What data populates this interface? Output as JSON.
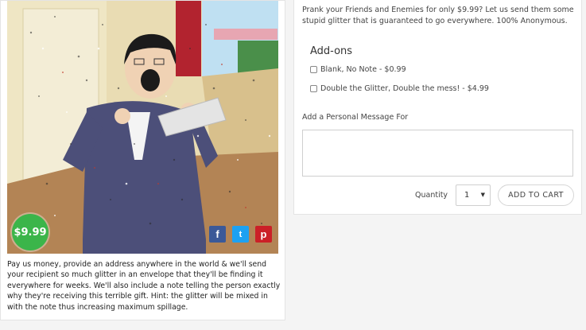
{
  "product": {
    "price_badge": "$9.99",
    "description": "Pay us money, provide an address anywhere in the world & we'll send your recipient so much glitter in an envelope that they'll be finding it everywhere for weeks. We'll also include a note telling the person exactly why they're receiving this terrible gift. Hint: the glitter will be mixed in with the note thus increasing maximum spillage.",
    "share": {
      "facebook": "f",
      "twitter": "t",
      "pinterest": "p"
    }
  },
  "purchase": {
    "intro": "Prank your Friends and Enemies for only $9.99? Let us send them some stupid glitter that is guaranteed to go everywhere. 100% Anonymous.",
    "addons_title": "Add-ons",
    "addons": [
      {
        "label": "Blank, No Note - $0.99",
        "checked": false
      },
      {
        "label": "Double the Glitter, Double the mess! - $4.99",
        "checked": false
      }
    ],
    "message_label": "Add a Personal Message For",
    "message_value": "",
    "quantity_label": "Quantity",
    "quantity_value": "1",
    "add_to_cart": "ADD TO CART"
  },
  "colors": {
    "price_badge": "#3bb54a",
    "facebook": "#3b5998",
    "twitter": "#1da1f2",
    "pinterest": "#cb2027"
  }
}
